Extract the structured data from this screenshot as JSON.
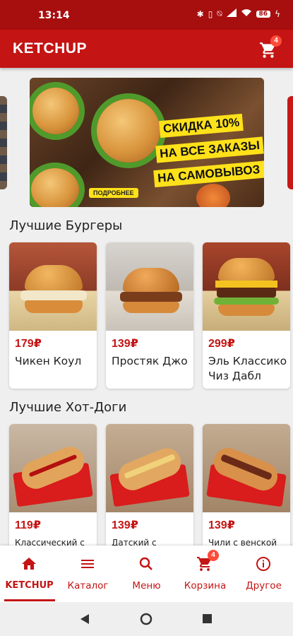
{
  "status_bar": {
    "time": "13:14",
    "battery": "86"
  },
  "app_bar": {
    "title": "KETCHUP",
    "cart_badge": "4"
  },
  "banner": {
    "promo_lines": [
      "СКИДКА 10%",
      "НА ВСЕ ЗАКАЗЫ",
      "НА САМОВЫВОЗ !"
    ],
    "more_button": "ПОДРОБНЕЕ"
  },
  "sections": [
    {
      "title": "Лучшие Бургеры",
      "items": [
        {
          "price": "179₽",
          "name": "Чикен Коул"
        },
        {
          "price": "139₽",
          "name": "Простяк Джо"
        },
        {
          "price": "299₽",
          "name": "Эль Классико Чиз Дабл"
        }
      ]
    },
    {
      "title": "Лучшие Хот-Доги",
      "items": [
        {
          "price": "119₽",
          "name": "Классический с"
        },
        {
          "price": "139₽",
          "name": "Датский с"
        },
        {
          "price": "139₽",
          "name": "Чили с венской"
        }
      ]
    }
  ],
  "bottom_nav": {
    "items": [
      {
        "label": "KETCHUP",
        "icon": "home-icon",
        "active": true
      },
      {
        "label": "Каталог",
        "icon": "menu-lines-icon"
      },
      {
        "label": "Меню",
        "icon": "search-icon"
      },
      {
        "label": "Корзина",
        "icon": "cart-icon",
        "badge": "4"
      },
      {
        "label": "Другое",
        "icon": "info-icon"
      }
    ]
  },
  "colors": {
    "brand_red": "#c41414",
    "status_red": "#a70e0e",
    "promo_yellow": "#ffe11a"
  }
}
